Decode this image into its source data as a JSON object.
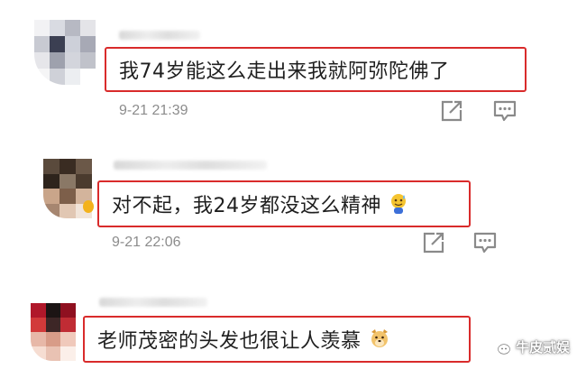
{
  "comments": [
    {
      "text": "我74岁能这么走出来我就阿弥陀佛了",
      "time": "9-21 21:39",
      "icons": [
        "share-icon",
        "comment-reply-icon"
      ]
    },
    {
      "text": "对不起，我24岁都没这么精神",
      "time": "9-21 22:06",
      "emoji": "sweat-smile-emoji",
      "icons": [
        "share-icon",
        "comment-reply-icon"
      ]
    },
    {
      "text": "老师茂密的头发也很让人羡慕",
      "emoji": "dog-emoji"
    }
  ],
  "watermark": {
    "text": "牛皮贰娱",
    "icon": "wechat-icon"
  },
  "colors": {
    "highlight": "#d92b2b",
    "meta_text": "#8c8c8c",
    "icon_stroke": "#8a8a8a"
  }
}
